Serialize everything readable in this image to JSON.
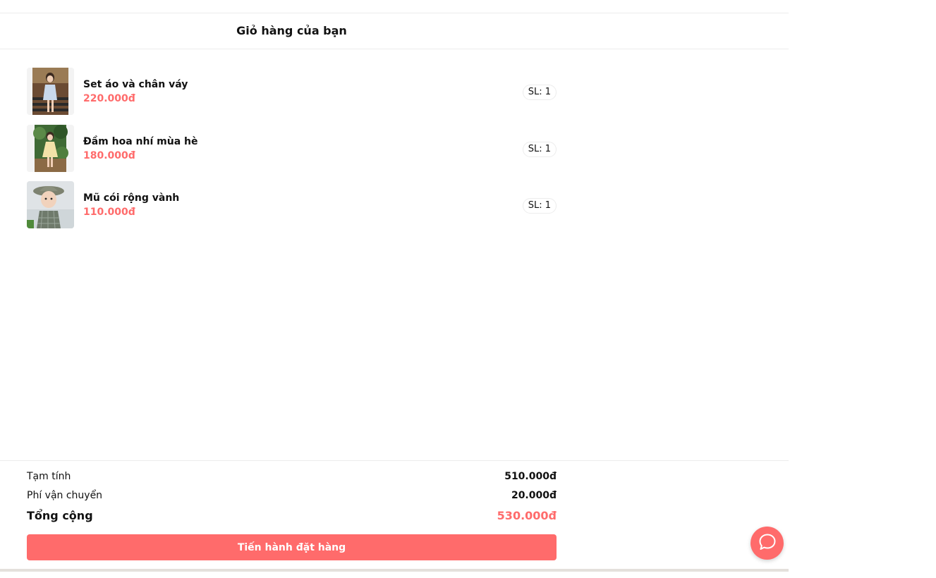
{
  "header": {
    "title": "Giỏ hàng của bạn"
  },
  "cart": {
    "items": [
      {
        "name": "Set áo và chân váy",
        "price": "220.000đ",
        "qty": "SL: 1",
        "image": "girl-in-blue-outfit-photo"
      },
      {
        "name": "Đầm hoa nhí mùa hè",
        "price": "180.000đ",
        "qty": "SL: 1",
        "image": "girl-in-yellow-dress-photo"
      },
      {
        "name": "Mũ cói rộng vành",
        "price": "110.000đ",
        "qty": "SL: 1",
        "image": "child-with-sun-hat-photo"
      }
    ]
  },
  "summary": {
    "subtotal_label": "Tạm tính",
    "subtotal_value": "510.000đ",
    "shipping_label": "Phí vận chuyển",
    "shipping_value": "20.000đ",
    "total_label": "Tổng cộng",
    "total_value": "530.000đ"
  },
  "checkout": {
    "label": "Tiến hành đặt hàng"
  },
  "chat": {
    "icon": "chat-bubble-icon"
  },
  "colors": {
    "accent": "#ff6b6b",
    "text": "#111111",
    "border": "#ececec"
  }
}
